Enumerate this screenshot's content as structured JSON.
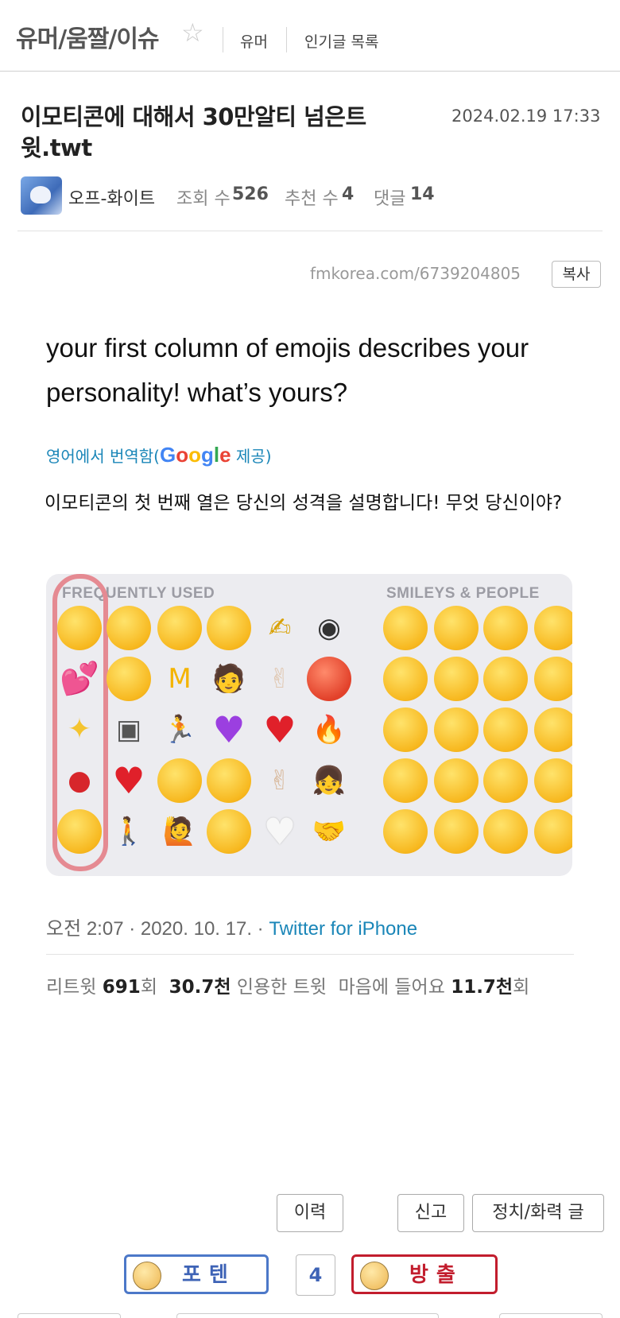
{
  "header": {
    "board_title": "유머/움짤/이슈",
    "star_icon": "star-outline-icon",
    "nav": [
      "유머",
      "인기글 목록"
    ]
  },
  "post": {
    "title": "이모티콘에 대해서 30만알티 넘은트윗.twt",
    "date": "2024.02.19 17:33",
    "author": "오프-화이트",
    "views_label": "조회 수",
    "views": "526",
    "likes_label": "추천 수",
    "likes": "4",
    "comments_label": "댓글",
    "comments": "14",
    "url": "fmkorea.com/6739204805",
    "copy_label": "복사"
  },
  "tweet": {
    "text_en": "your first column of emojis describes your personality! what’s yours?",
    "translate_prefix": "영어에서 번역함(",
    "translate_google": "Google",
    "translate_suffix": " 제공)",
    "text_ko": "이모티콘의 첫 번째 열은 당신의 성격을 설명합니다! 무엇 당신이야?",
    "panel_left_label": "FREQUENTLY USED",
    "panel_right_label": "SMILEYS & PEOPLE",
    "footer_time": "오전 2:07 · 2020. 10. 17. · ",
    "footer_source": "Twitter for iPhone",
    "stats": {
      "retweet_label": "리트윗",
      "retweets": "691",
      "retweet_unit": "회",
      "quotes": "30.7천",
      "quote_label": "인용한 트윗",
      "likes_label": "마음에 들어요",
      "likes": "11.7천",
      "likes_unit": "회"
    }
  },
  "actions": {
    "history": "이력",
    "report": "신고",
    "politics": "정치/화력 글",
    "upvote": "포텐",
    "vote_count": "4",
    "downvote": "방출"
  },
  "colors": {
    "link": "#1a86b8",
    "upvote": "#3e63b6",
    "downvote": "#c21d2d",
    "highlight": "#e58a92"
  }
}
